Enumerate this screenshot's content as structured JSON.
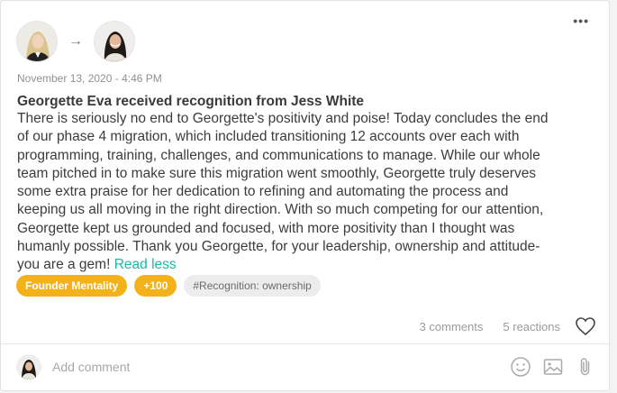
{
  "post": {
    "more_label": "•••",
    "arrow": "→",
    "timestamp": "November 13, 2020 - 4:46 PM",
    "title": "Georgette Eva received recognition from Jess White",
    "body": "There is seriously no end to Georgette's positivity and poise!  Today concludes the end\nof our phase 4 migration, which included transitioning 12 accounts over each with\nprogramming, training, challenges, and communications to manage.  While our whole\nteam pitched in to make sure this migration went smoothly, Georgette truly deserves\nsome extra praise for her dedication to refining and automating the process and\nkeeping us all moving in the right direction.  With so much competing for our attention,\nGeorgette kept us grounded and focused, with more positivity than I thought was\nhumanly possible.  Thank you Georgette, for your leadership, ownership and attitude-\nyou are a gem! ",
    "read_less": "Read less"
  },
  "tags": {
    "value": "Founder Mentality",
    "points": "+100",
    "hashtag": "#Recognition: ownership"
  },
  "stats": {
    "comments": "3 comments",
    "reactions": "5 reactions"
  },
  "comment": {
    "placeholder": "Add comment"
  },
  "colors": {
    "accent": "#1ab9a8",
    "badge": "#f4b21a"
  },
  "icons": [
    "more-options-icon",
    "arrow-right-icon",
    "heart-icon",
    "emoji-icon",
    "image-icon",
    "attachment-icon"
  ]
}
